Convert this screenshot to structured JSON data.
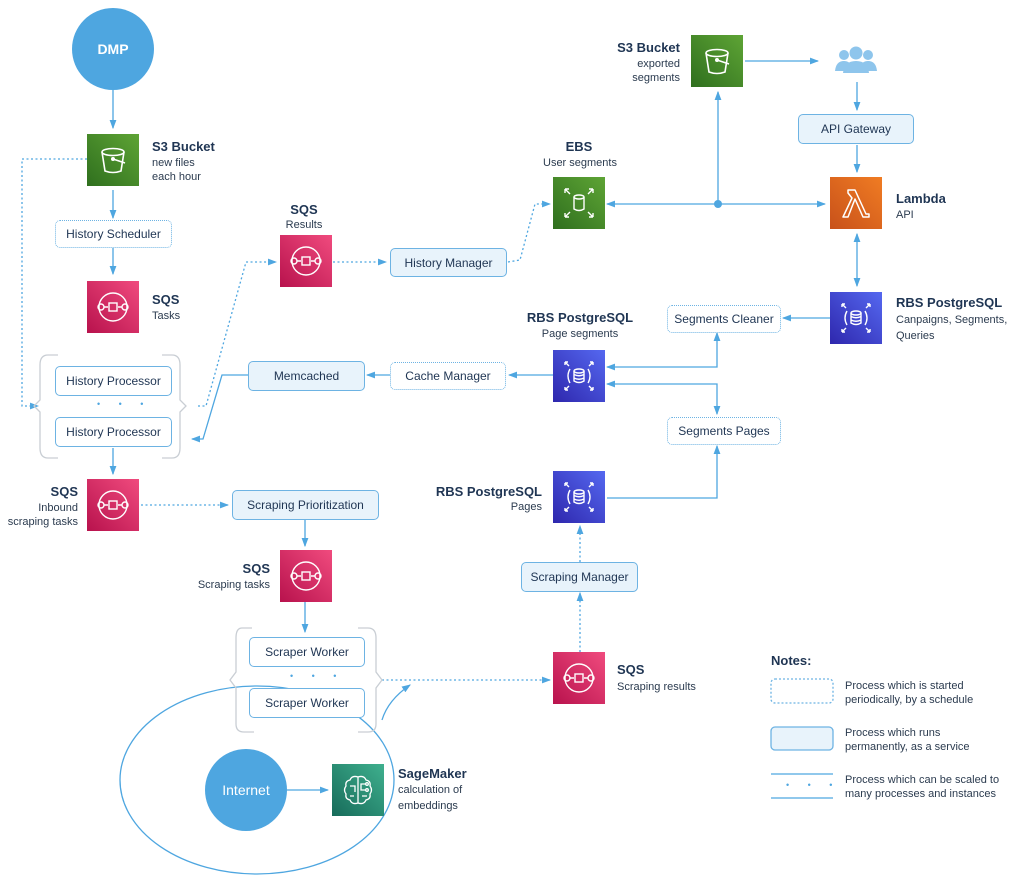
{
  "nodes": {
    "dmp": {
      "label": "DMP"
    },
    "s3_new_files": {
      "title": "S3 Bucket",
      "subtitle_1": "new files",
      "subtitle_2": "each hour"
    },
    "history_scheduler": {
      "label": "History Scheduler"
    },
    "sqs_tasks": {
      "title": "SQS",
      "subtitle": "Tasks"
    },
    "history_processor_1": {
      "label": "History Processor"
    },
    "history_processor_2": {
      "label": "History Processor"
    },
    "sqs_results": {
      "title": "SQS",
      "subtitle": "Results"
    },
    "history_manager": {
      "label": "History Manager"
    },
    "ebs": {
      "title": "EBS",
      "subtitle": "User segments"
    },
    "s3_exported": {
      "title": "S3 Bucket",
      "subtitle_1": "exported",
      "subtitle_2": "segments"
    },
    "api_gateway": {
      "label": "API Gateway"
    },
    "lambda": {
      "title": "Lambda",
      "subtitle": "API"
    },
    "rds_campaigns": {
      "title": "RBS PostgreSQL",
      "subtitle_1": "Canpaigns, Segments,",
      "subtitle_2": "Queries"
    },
    "segments_cleaner": {
      "label": "Segments Cleaner"
    },
    "rds_page_segments": {
      "title": "RBS PostgreSQL",
      "subtitle": "Page segments"
    },
    "cache_manager": {
      "label": "Cache Manager"
    },
    "memcached": {
      "label": "Memcached"
    },
    "segments_pages": {
      "label": "Segments Pages"
    },
    "sqs_inbound": {
      "title": "SQS",
      "subtitle_1": "Inbound",
      "subtitle_2": "scraping tasks"
    },
    "scraping_prioritization": {
      "label": "Scraping Prioritization"
    },
    "rds_pages": {
      "title": "RBS PostgreSQL",
      "subtitle": "Pages"
    },
    "sqs_scraping_tasks": {
      "title": "SQS",
      "subtitle": "Scraping tasks"
    },
    "scraping_manager": {
      "label": "Scraping Manager"
    },
    "scraper_worker_1": {
      "label": "Scraper Worker"
    },
    "scraper_worker_2": {
      "label": "Scraper Worker"
    },
    "sqs_scraping_results": {
      "title": "SQS",
      "subtitle": "Scraping results"
    },
    "internet": {
      "label": "Internet"
    },
    "sagemaker": {
      "title": "SageMaker",
      "subtitle_1": "calculation of",
      "subtitle_2": "embeddings"
    }
  },
  "scale_dots": "• • •",
  "notes": {
    "title": "Notes:",
    "scheduled": {
      "line_1": "Process which is started",
      "line_2": "periodically, by a schedule"
    },
    "service": {
      "line_1": "Process which runs",
      "line_2": "permanently, as a service"
    },
    "scaled": {
      "line_1": "Process which can be scaled to",
      "line_2": "many processes and instances"
    }
  },
  "colors": {
    "accent": "#4ea6e0",
    "text": "#1f3553",
    "s3": "#3f8624",
    "sqs": "#d6245f",
    "lambda": "#e06a1b",
    "rds": "#3b48cc",
    "sagemaker": "#1f8a6e"
  }
}
